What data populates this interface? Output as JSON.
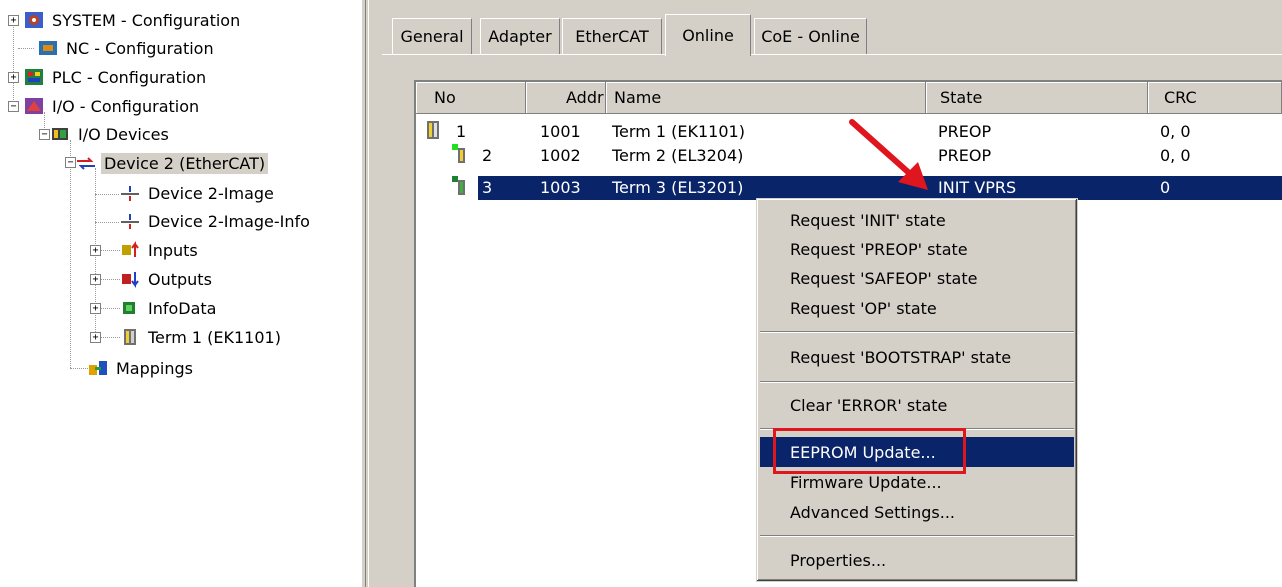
{
  "tree": {
    "items": [
      {
        "label": "SYSTEM - Configuration",
        "icon": "system-config-icon"
      },
      {
        "label": "NC - Configuration",
        "icon": "nc-config-icon"
      },
      {
        "label": "PLC - Configuration",
        "icon": "plc-config-icon"
      },
      {
        "label": "I/O - Configuration",
        "icon": "io-config-icon"
      },
      {
        "label": "I/O Devices",
        "icon": "io-devices-icon"
      },
      {
        "label": "Device 2 (EtherCAT)",
        "icon": "ethercat-device-icon"
      },
      {
        "label": "Device 2-Image",
        "icon": "device-image-icon"
      },
      {
        "label": "Device 2-Image-Info",
        "icon": "device-image-info-icon"
      },
      {
        "label": "Inputs",
        "icon": "inputs-icon"
      },
      {
        "label": "Outputs",
        "icon": "outputs-icon"
      },
      {
        "label": "InfoData",
        "icon": "infodata-icon"
      },
      {
        "label": "Term 1 (EK1101)",
        "icon": "terminal-icon"
      },
      {
        "label": "Mappings",
        "icon": "mappings-icon"
      }
    ]
  },
  "tabs": [
    "General",
    "Adapter",
    "EtherCAT",
    "Online",
    "CoE - Online"
  ],
  "active_tab": "Online",
  "table": {
    "columns": [
      "No",
      "Addr",
      "Name",
      "State",
      "CRC"
    ],
    "rows": [
      {
        "no": "1",
        "addr": "1001",
        "name": "Term 1 (EK1101)",
        "state": "PREOP",
        "crc": "0, 0"
      },
      {
        "no": "2",
        "addr": "1002",
        "name": "Term 2 (EL3204)",
        "state": "PREOP",
        "crc": "0, 0"
      },
      {
        "no": "3",
        "addr": "1003",
        "name": "Term 3 (EL3201)",
        "state": "INIT VPRS",
        "crc": "0"
      }
    ]
  },
  "context_menu": {
    "items": [
      "Request 'INIT' state",
      "Request 'PREOP' state",
      "Request 'SAFEOP' state",
      "Request 'OP' state",
      "Request 'BOOTSTRAP' state",
      "Clear 'ERROR' state",
      "EEPROM Update...",
      "Firmware Update...",
      "Advanced Settings...",
      "Properties..."
    ],
    "highlighted": "EEPROM Update..."
  },
  "colors": {
    "selection": "#0a246a",
    "annotation_red": "#e0161e",
    "face": "#d4d0c8"
  }
}
